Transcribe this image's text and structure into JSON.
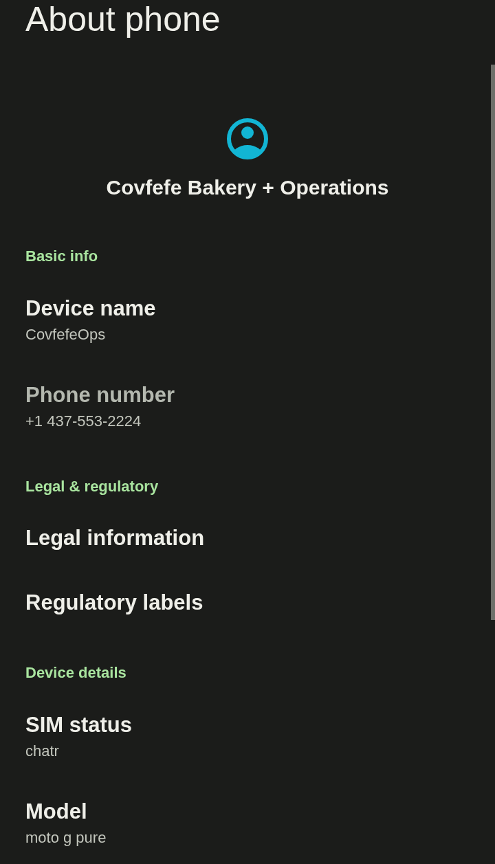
{
  "app_bar": {
    "title": "About phone"
  },
  "header": {
    "device_title": "Covfefe Bakery + Operations"
  },
  "sections": [
    {
      "title": "Basic info",
      "items": [
        {
          "title": "Device name",
          "summary": "CovfefeOps",
          "disabled": false
        },
        {
          "title": "Phone number",
          "summary": "+1 437-553-2224",
          "disabled": true
        }
      ]
    },
    {
      "title": "Legal & regulatory",
      "items": [
        {
          "title": "Legal information",
          "disabled": false
        },
        {
          "title": "Regulatory labels",
          "disabled": false
        }
      ]
    },
    {
      "title": "Device details",
      "items": [
        {
          "title": "SIM status",
          "summary": "chatr",
          "disabled": false
        },
        {
          "title": "Model",
          "summary": "moto g pure",
          "disabled": false
        }
      ]
    }
  ]
}
